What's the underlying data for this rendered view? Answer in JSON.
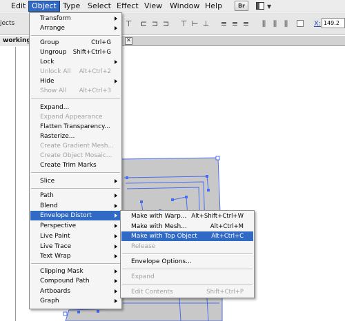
{
  "menubar": {
    "items": [
      "Edit",
      "Object",
      "Type",
      "Select",
      "Effect",
      "View",
      "Window",
      "Help"
    ],
    "active": "Object",
    "bridge_label": "Br"
  },
  "controlbar": {
    "objects_label": "jects",
    "x_label": "X:",
    "x_value": "149.2"
  },
  "tabbar": {
    "doc_tab": "working",
    "close_glyph": "✕"
  },
  "object_menu": {
    "items": [
      {
        "label": "Transform",
        "shortcut": "",
        "submenu": true,
        "enabled": true
      },
      {
        "label": "Arrange",
        "shortcut": "",
        "submenu": true,
        "enabled": true
      },
      {
        "label": "Group",
        "shortcut": "Ctrl+G",
        "submenu": false,
        "enabled": true
      },
      {
        "label": "Ungroup",
        "shortcut": "Shift+Ctrl+G",
        "submenu": false,
        "enabled": true
      },
      {
        "label": "Lock",
        "shortcut": "",
        "submenu": true,
        "enabled": true
      },
      {
        "label": "Unlock All",
        "shortcut": "Alt+Ctrl+2",
        "submenu": false,
        "enabled": false
      },
      {
        "label": "Hide",
        "shortcut": "",
        "submenu": true,
        "enabled": true
      },
      {
        "label": "Show All",
        "shortcut": "Alt+Ctrl+3",
        "submenu": false,
        "enabled": false
      },
      {
        "label": "Expand...",
        "shortcut": "",
        "submenu": false,
        "enabled": true
      },
      {
        "label": "Expand Appearance",
        "shortcut": "",
        "submenu": false,
        "enabled": false
      },
      {
        "label": "Flatten Transparency...",
        "shortcut": "",
        "submenu": false,
        "enabled": true
      },
      {
        "label": "Rasterize...",
        "shortcut": "",
        "submenu": false,
        "enabled": true
      },
      {
        "label": "Create Gradient Mesh...",
        "shortcut": "",
        "submenu": false,
        "enabled": false
      },
      {
        "label": "Create Object Mosaic...",
        "shortcut": "",
        "submenu": false,
        "enabled": false
      },
      {
        "label": "Create Trim Marks",
        "shortcut": "",
        "submenu": false,
        "enabled": true
      },
      {
        "label": "Slice",
        "shortcut": "",
        "submenu": true,
        "enabled": true
      },
      {
        "label": "Path",
        "shortcut": "",
        "submenu": true,
        "enabled": true
      },
      {
        "label": "Blend",
        "shortcut": "",
        "submenu": true,
        "enabled": true
      },
      {
        "label": "Envelope Distort",
        "shortcut": "",
        "submenu": true,
        "enabled": true
      },
      {
        "label": "Perspective",
        "shortcut": "",
        "submenu": true,
        "enabled": true
      },
      {
        "label": "Live Paint",
        "shortcut": "",
        "submenu": true,
        "enabled": true
      },
      {
        "label": "Live Trace",
        "shortcut": "",
        "submenu": true,
        "enabled": true
      },
      {
        "label": "Text Wrap",
        "shortcut": "",
        "submenu": true,
        "enabled": true
      },
      {
        "label": "Clipping Mask",
        "shortcut": "",
        "submenu": true,
        "enabled": true
      },
      {
        "label": "Compound Path",
        "shortcut": "",
        "submenu": true,
        "enabled": true
      },
      {
        "label": "Artboards",
        "shortcut": "",
        "submenu": true,
        "enabled": true
      },
      {
        "label": "Graph",
        "shortcut": "",
        "submenu": true,
        "enabled": true
      }
    ]
  },
  "envelope_submenu": {
    "items": [
      {
        "label": "Make with Warp...",
        "shortcut": "Alt+Shift+Ctrl+W",
        "enabled": true
      },
      {
        "label": "Make with Mesh...",
        "shortcut": "Alt+Ctrl+M",
        "enabled": true
      },
      {
        "label": "Make with Top Object",
        "shortcut": "Alt+Ctrl+C",
        "enabled": true
      },
      {
        "label": "Release",
        "shortcut": "",
        "enabled": false
      },
      {
        "label": "Envelope Options...",
        "shortcut": "",
        "enabled": true
      },
      {
        "label": "Expand",
        "shortcut": "",
        "enabled": false
      },
      {
        "label": "Edit Contents",
        "shortcut": "Shift+Ctrl+P",
        "enabled": false
      }
    ]
  },
  "colors": {
    "highlight": "#316ac5",
    "selection": "#4a6cf0",
    "artwork_fill": "#c8c8c8"
  }
}
